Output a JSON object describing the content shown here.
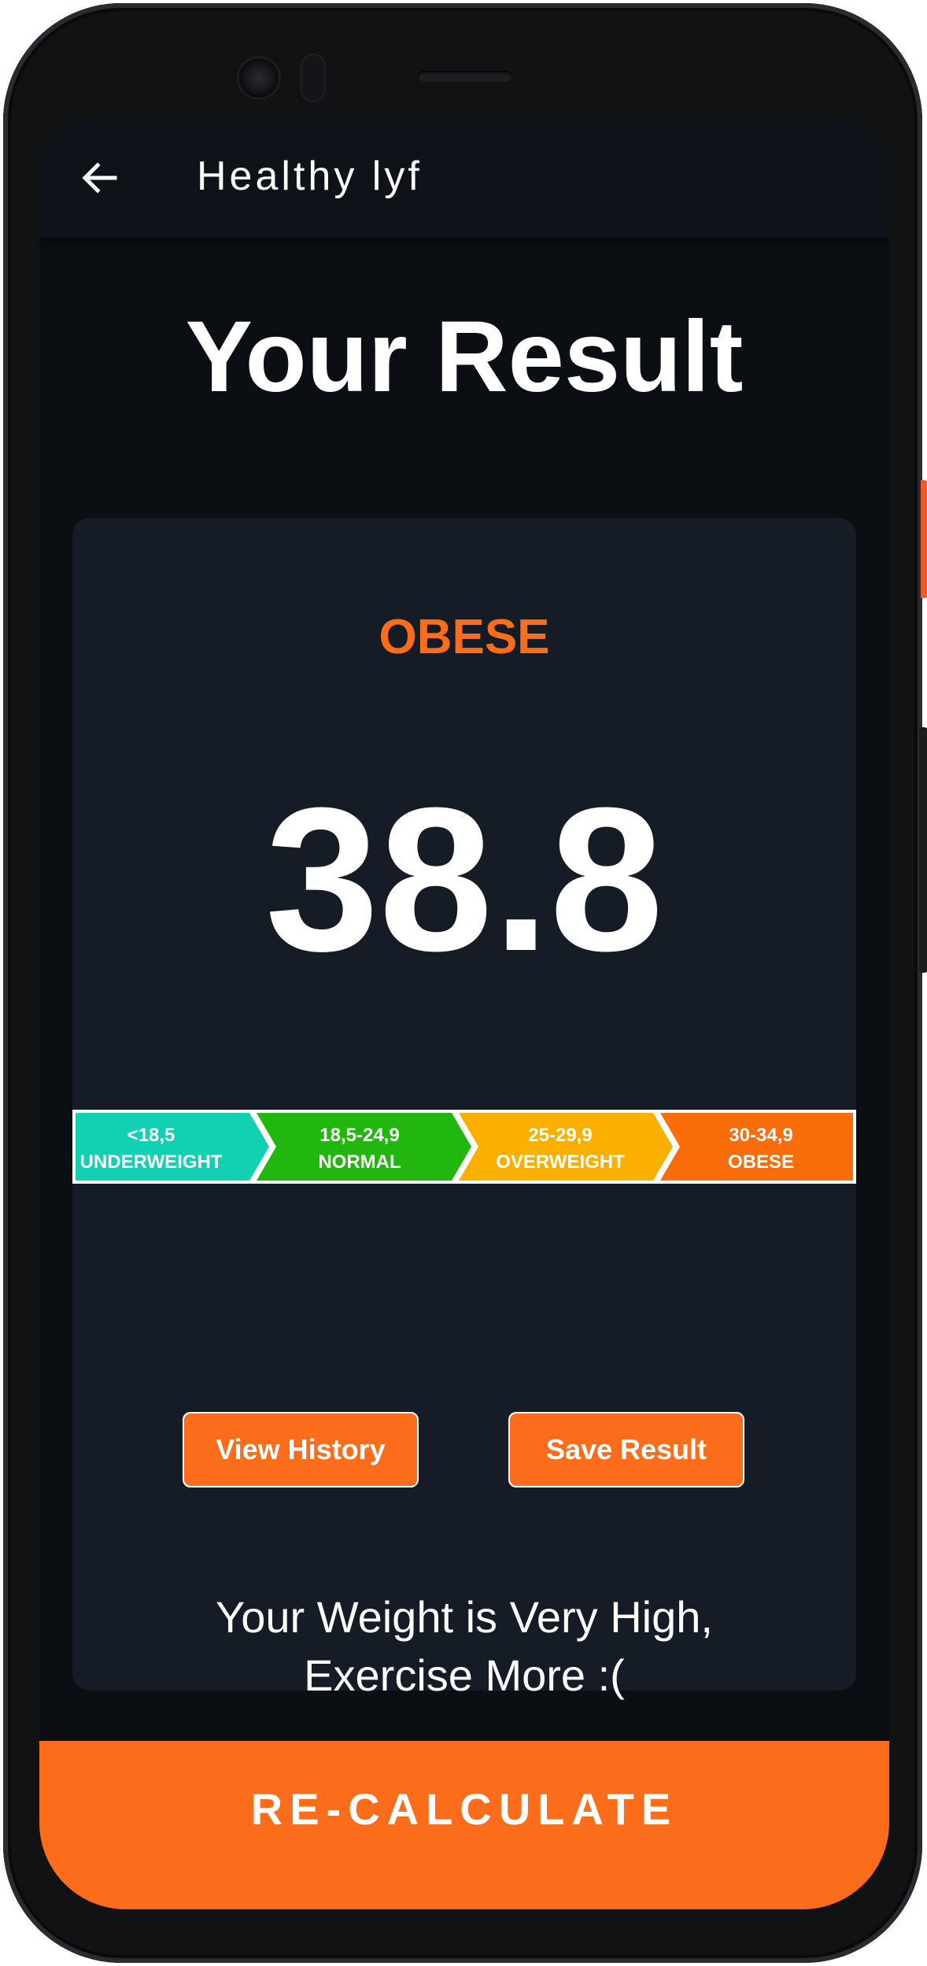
{
  "app": {
    "title": "Healthy lyf"
  },
  "page": {
    "title": "Your Result"
  },
  "result": {
    "category": "OBESE",
    "bmi": "38.8",
    "message_line1": "Your Weight is Very High,",
    "message_line2": "Exercise More :("
  },
  "scale": [
    {
      "range": "<18,5",
      "label": "UNDERWEIGHT",
      "color": "#12d1b2"
    },
    {
      "range": "18,5-24,9",
      "label": "NORMAL",
      "color": "#21b70f"
    },
    {
      "range": "25-29,9",
      "label": "OVERWEIGHT",
      "color": "#fbb000"
    },
    {
      "range": "30-34,9",
      "label": "OBESE",
      "color": "#fb6d0a"
    }
  ],
  "actions": {
    "view_history": "View History",
    "save_result": "Save Result",
    "recalculate": "RE-CALCULATE"
  },
  "icons": {
    "back": "arrow-left-icon"
  },
  "colors": {
    "accent": "#fb6d1a",
    "background": "#0b0f14",
    "card": "#161c26"
  }
}
